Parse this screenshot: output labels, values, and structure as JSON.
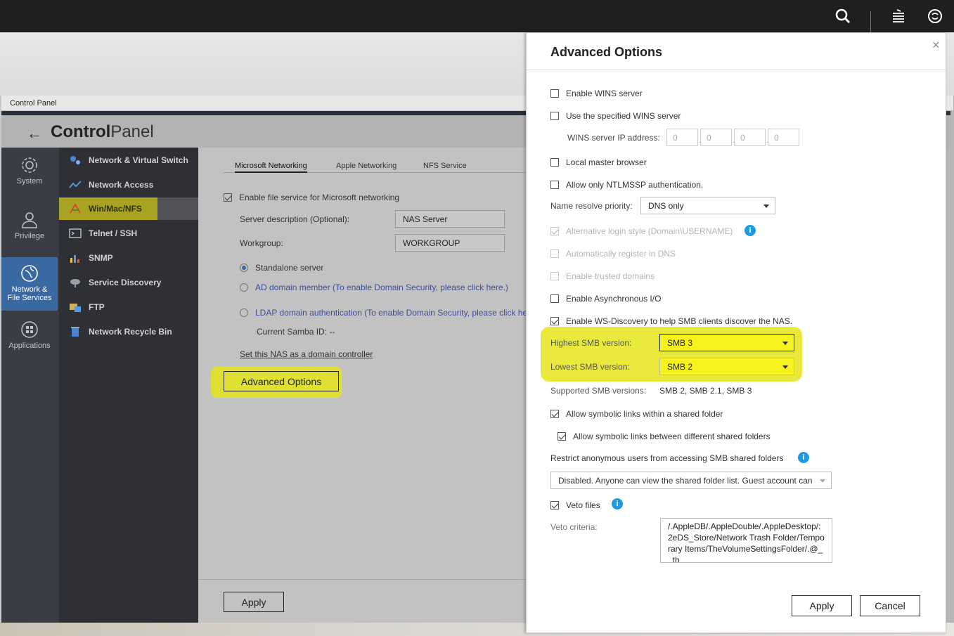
{
  "topbar": {
    "icons": [
      "search-icon",
      "stack-icon",
      "sync-icon"
    ]
  },
  "window": {
    "titlebar": "Control Panel",
    "header": {
      "title_bold": "Control",
      "title_light": "Panel"
    }
  },
  "categories": [
    {
      "label": "System",
      "icon": "gear-icon"
    },
    {
      "label": "Privilege",
      "icon": "user-icon"
    },
    {
      "label": "Network &\nFile Services",
      "icon": "globe-icon",
      "active": true
    },
    {
      "label": "Applications",
      "icon": "apps-icon"
    }
  ],
  "subitems": [
    {
      "label": "Network & Virtual Switch",
      "icon": "network-switch-icon"
    },
    {
      "label": "Network Access",
      "icon": "network-access-icon"
    },
    {
      "label": "Win/Mac/NFS",
      "icon": "win-mac-nfs-icon",
      "active": true
    },
    {
      "label": "Telnet / SSH",
      "icon": "terminal-icon"
    },
    {
      "label": "SNMP",
      "icon": "snmp-icon"
    },
    {
      "label": "Service Discovery",
      "icon": "satellite-icon"
    },
    {
      "label": "FTP",
      "icon": "ftp-icon"
    },
    {
      "label": "Network Recycle Bin",
      "icon": "recycle-bin-icon"
    }
  ],
  "main": {
    "tabs": [
      "Microsoft Networking",
      "Apple Networking",
      "NFS Service"
    ],
    "enable_label": "Enable file service for Microsoft networking",
    "server_desc_label": "Server description (Optional):",
    "server_desc_value": "NAS Server",
    "workgroup_label": "Workgroup:",
    "workgroup_value": "WORKGROUP",
    "radio_standalone": "Standalone server",
    "radio_ad": "AD domain member (To enable Domain Security, please click here.)",
    "radio_ldap": "LDAP domain authentication (To enable Domain Security, please click he",
    "samba_id": "Current Samba ID: --",
    "domain_controller_link": "Set this NAS as a domain controller",
    "advanced_button": "Advanced Options",
    "apply_button": "Apply"
  },
  "panel": {
    "title": "Advanced Options",
    "enable_wins": "Enable WINS server",
    "use_wins": "Use the specified WINS server",
    "wins_ip_label": "WINS server IP address:",
    "wins_ip": [
      "0",
      "0",
      "0",
      "0"
    ],
    "local_master": "Local master browser",
    "ntlmssp": "Allow only NTLMSSP authentication.",
    "name_resolve_label": "Name resolve priority:",
    "name_resolve_value": "DNS only",
    "alt_login": "Alternative login style (Domain\\USERNAME)",
    "auto_register": "Automatically register in DNS",
    "trusted_domains": "Enable trusted domains",
    "async_io": "Enable Asynchronous I/O",
    "ws_discovery": "Enable WS-Discovery to help SMB clients discover the NAS.",
    "highest_label": "Highest SMB version:",
    "highest_value": "SMB 3",
    "lowest_label": "Lowest SMB version:",
    "lowest_value": "SMB 2",
    "supported_label": "Supported SMB versions:",
    "supported_value": "SMB 2, SMB 2.1, SMB 3",
    "symlinks_within": "Allow symbolic links within a shared folder",
    "symlinks_between": "Allow symbolic links between different shared folders",
    "restrict_label": "Restrict anonymous users from accessing SMB shared folders",
    "restrict_value": "Disabled. Anyone can view the shared folder list. Guest account can",
    "veto_files": "Veto files",
    "veto_criteria_label": "Veto criteria:",
    "veto_criteria_value": "/.AppleDB/.AppleDouble/.AppleDesktop/:2eDS_Store/Network Trash Folder/Temporary Items/TheVolumeSettingsFolder/.@__th",
    "info_glyph": "i",
    "close_glyph": "×",
    "apply_button": "Apply",
    "cancel_button": "Cancel"
  },
  "colors": {
    "highlight": "#e5e51b",
    "accent": "#3a68a0",
    "info": "#1e9ae0"
  }
}
